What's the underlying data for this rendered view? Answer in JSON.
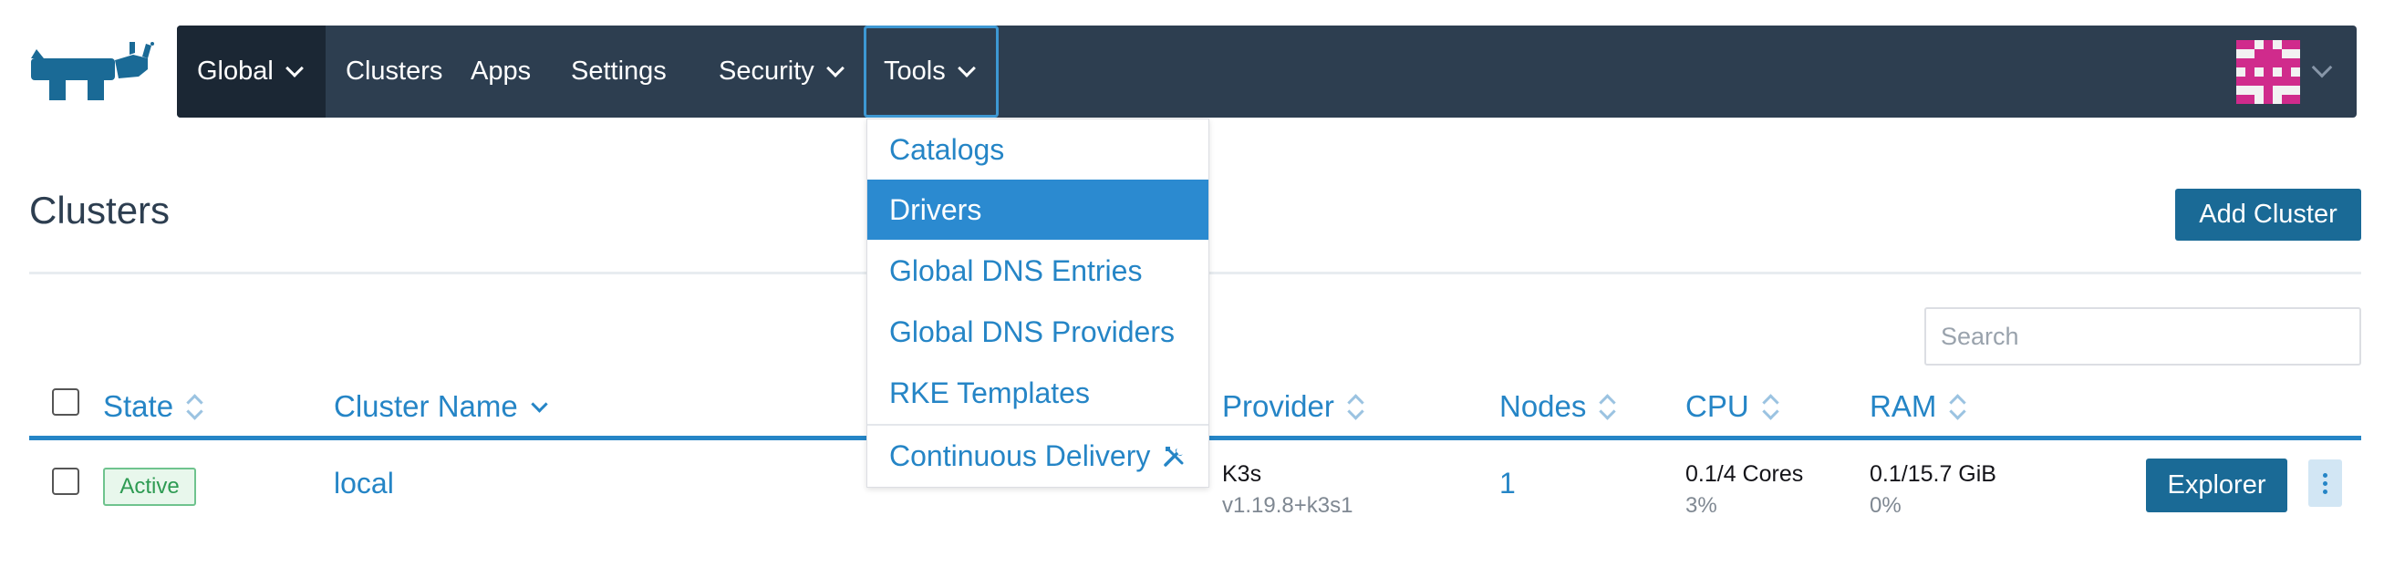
{
  "colors": {
    "navbar": "#2d3e50",
    "navbar_active": "#1b2734",
    "link": "#2585c6",
    "primary_button": "#1a6a96",
    "menu_highlight": "#2b8ad0",
    "active_badge": "#2e9b53"
  },
  "logo": {
    "icon": "rancher-cow-icon"
  },
  "nav": {
    "global_label": "Global",
    "clusters_label": "Clusters",
    "apps_label": "Apps",
    "settings_label": "Settings",
    "security_label": "Security",
    "tools_label": "Tools",
    "avatar_icon": "user-avatar-icon"
  },
  "tools_menu": {
    "items": [
      "Catalogs",
      "Drivers",
      "Global DNS Entries",
      "Global DNS Providers",
      "RKE Templates"
    ],
    "highlighted": "Drivers",
    "continuous_delivery": "Continuous Delivery",
    "continuous_delivery_icon": "tools-icon"
  },
  "page": {
    "title": "Clusters",
    "add_button": "Add Cluster",
    "search_placeholder": "Search"
  },
  "table": {
    "columns": {
      "state": "State",
      "cluster_name": "Cluster Name",
      "provider": "Provider",
      "nodes": "Nodes",
      "cpu": "CPU",
      "ram": "RAM"
    },
    "rows": [
      {
        "state": "Active",
        "cluster_name": "local",
        "provider": "K3s",
        "provider_version": "v1.19.8+k3s1",
        "nodes": "1",
        "cpu": "0.1/4 Cores",
        "cpu_pct": "3%",
        "ram": "0.1/15.7 GiB",
        "ram_pct": "0%",
        "action_button": "Explorer"
      }
    ]
  }
}
